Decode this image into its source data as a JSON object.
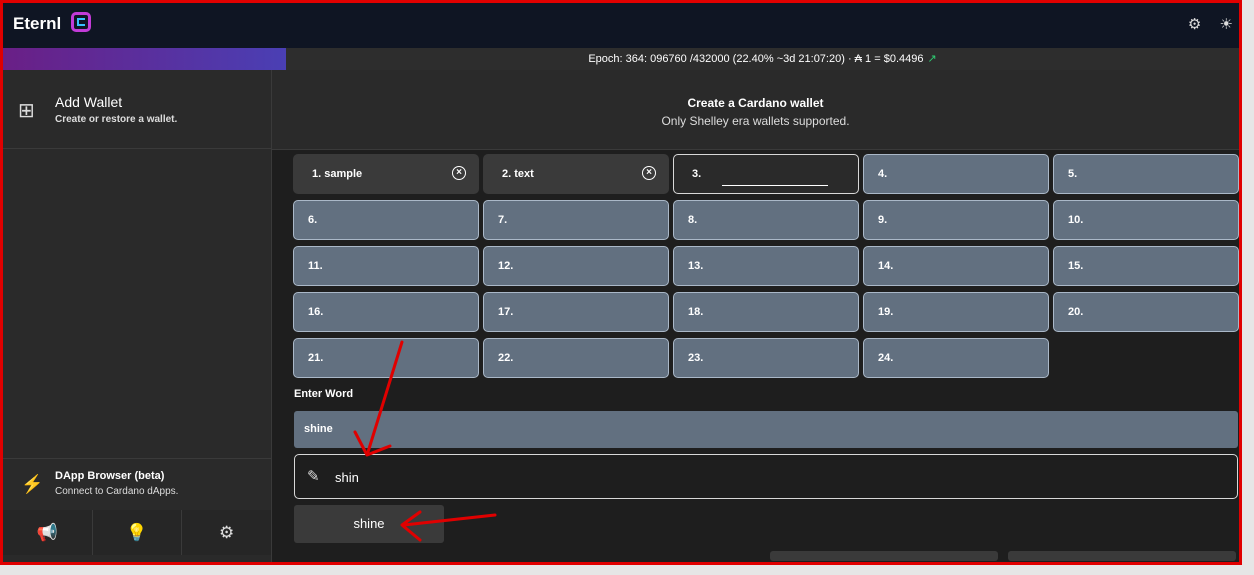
{
  "app": {
    "name": "Eternl"
  },
  "status": {
    "epoch_text": "Epoch: 364: 096760 /432000 (22.40% ~3d 21:07:20) · ₳ 1 = $0.4496",
    "progress_fraction": 0.224
  },
  "sidebar": {
    "add_wallet": {
      "title": "Add Wallet",
      "subtitle": "Create or restore a wallet."
    },
    "dapp": {
      "title": "DApp Browser (beta)",
      "subtitle": "Connect to Cardano dApps."
    },
    "bottom_icons": [
      "megaphone-icon",
      "lightbulb-icon",
      "gear-icon"
    ]
  },
  "main": {
    "title": "Create a Cardano wallet",
    "subtitle": "Only Shelley era wallets supported.",
    "words": [
      "1. sample",
      "2. text",
      "3.",
      "4.",
      "5.",
      "6.",
      "7.",
      "8.",
      "9.",
      "10.",
      "11.",
      "12.",
      "13.",
      "14.",
      "15.",
      "16.",
      "17.",
      "18.",
      "19.",
      "20.",
      "21.",
      "22.",
      "23.",
      "24."
    ],
    "enter_word_label": "Enter Word",
    "selected_word": "shine",
    "input_value": "shin",
    "suggestion": "shine"
  },
  "colors": {
    "accent": "#c23bd8",
    "annotation_arrow": "#e00000"
  }
}
